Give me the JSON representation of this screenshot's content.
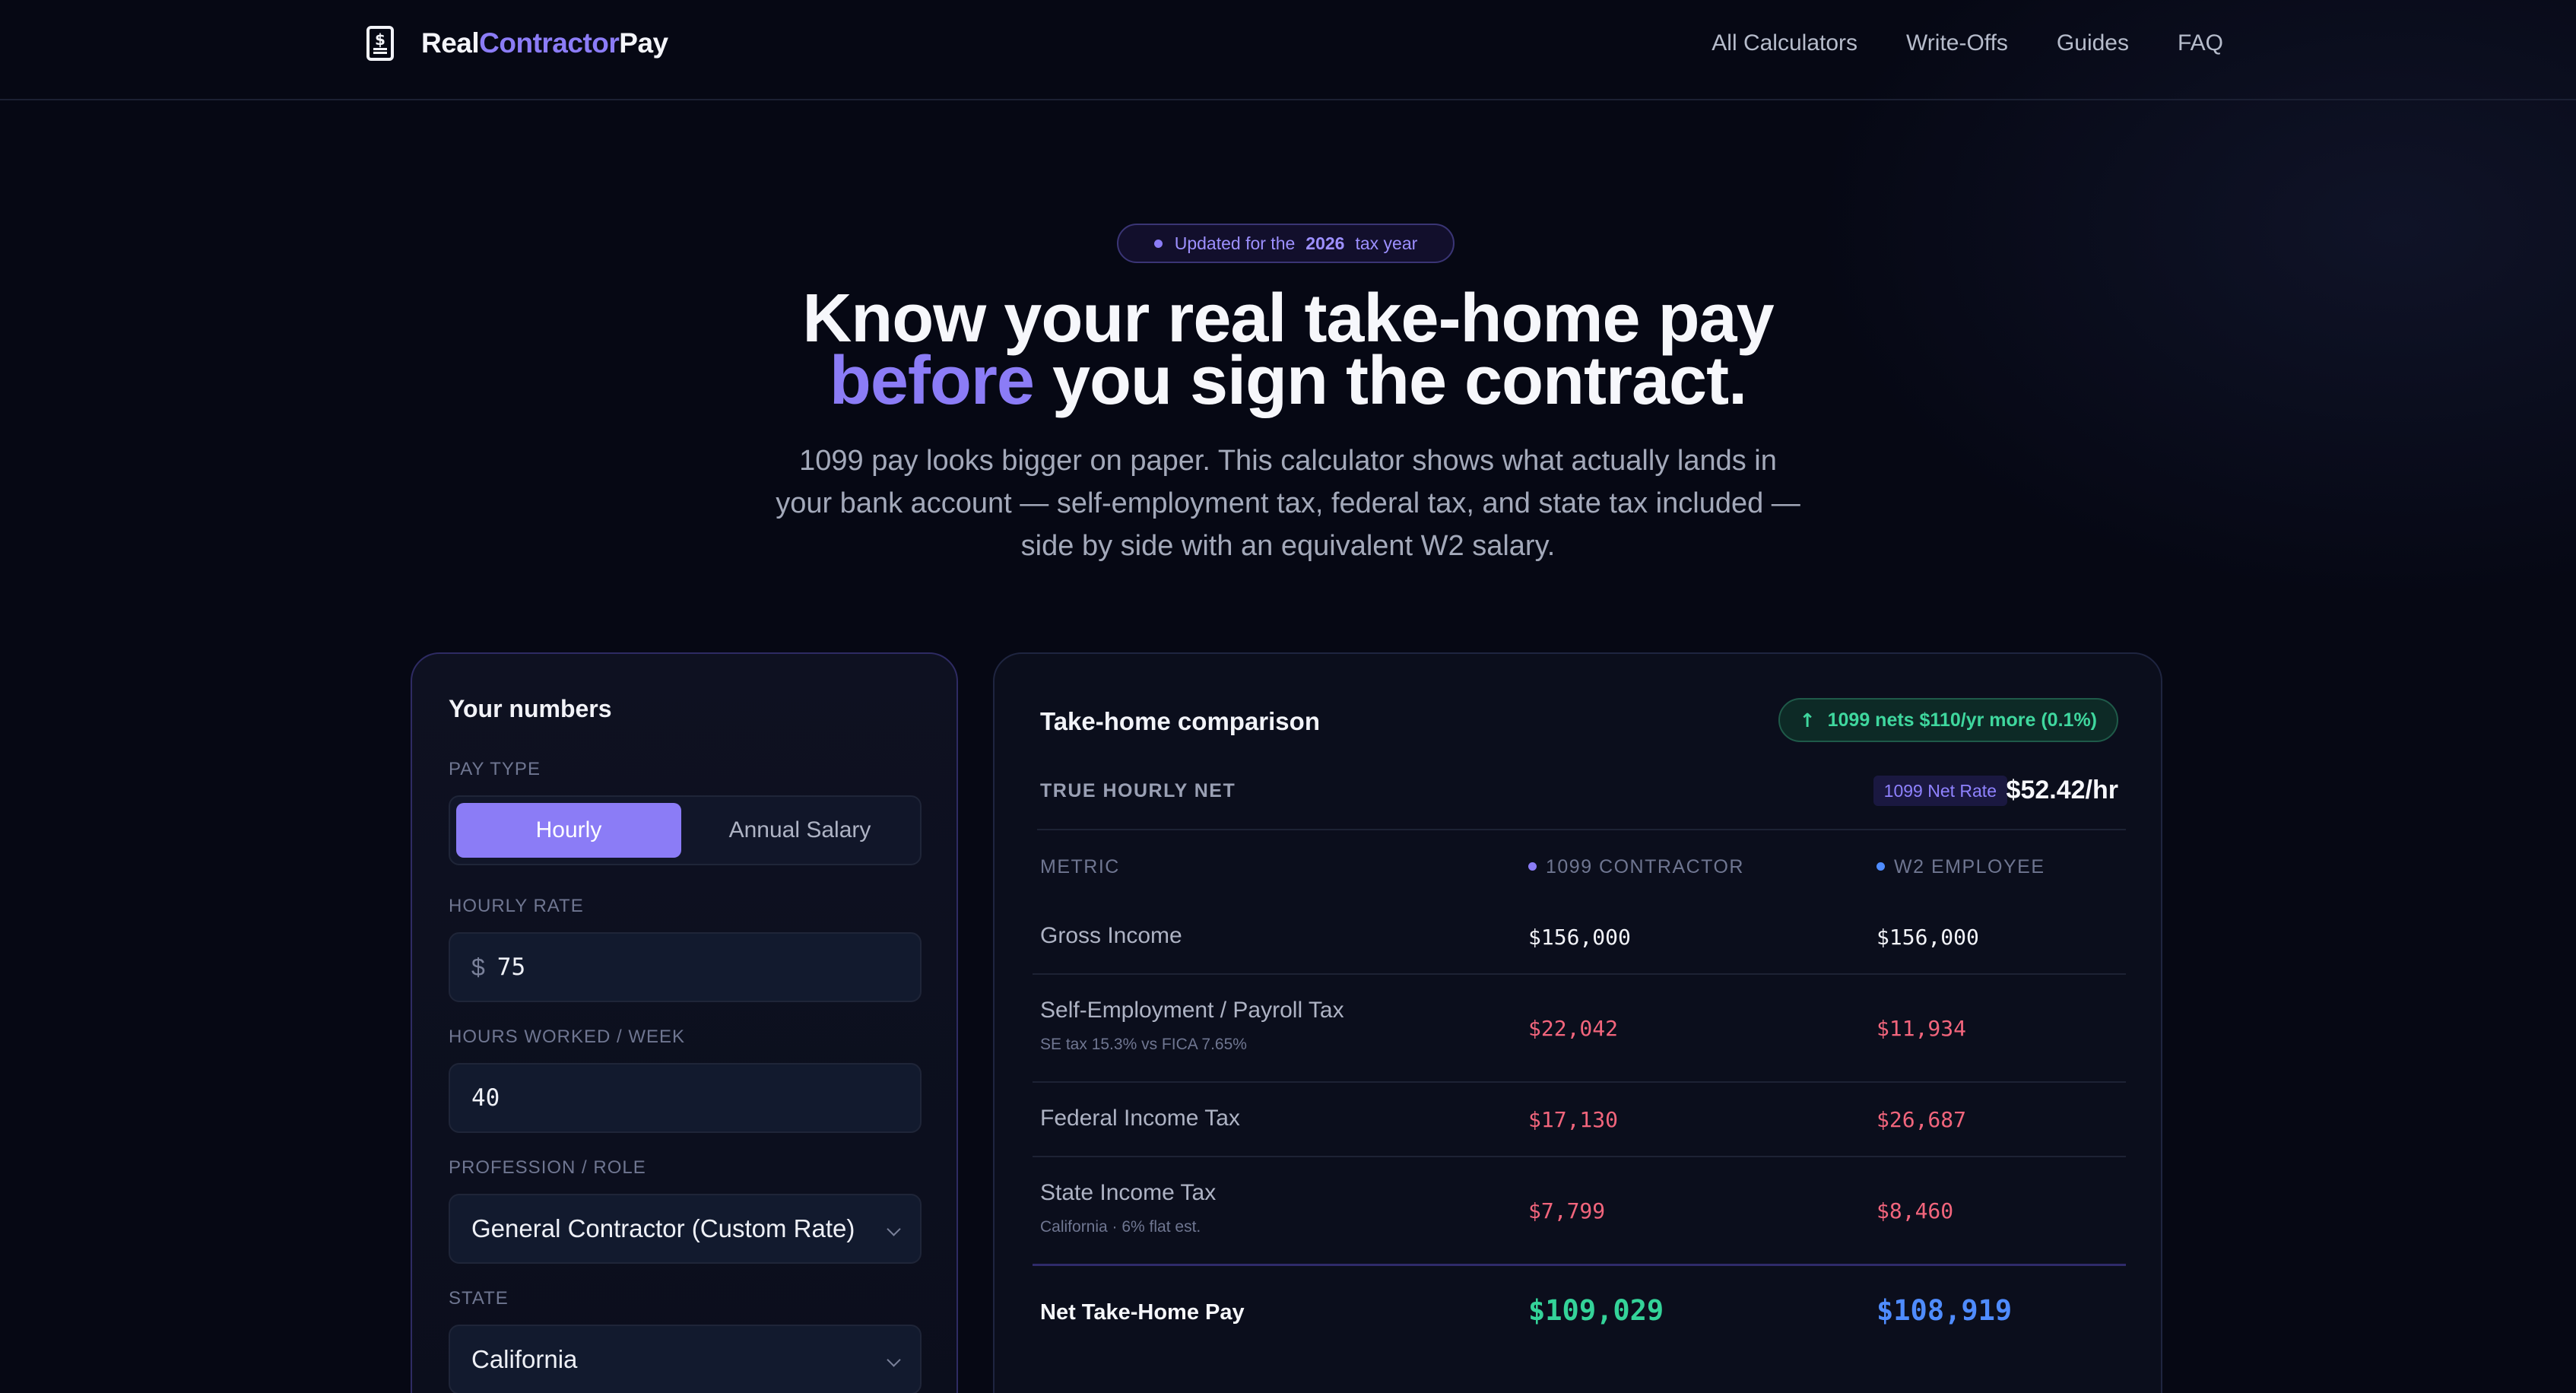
{
  "nav": {
    "brand": {
      "part1": "Real",
      "part2": "Contractor",
      "part3": "Pay"
    },
    "links": [
      "All Calculators",
      "Write-Offs",
      "Guides",
      "FAQ"
    ]
  },
  "hero": {
    "pill": {
      "before": "Updated for the",
      "year": "2026",
      "after": "tax year"
    },
    "title_line1": "Know your real take-home pay",
    "title_accent": "before",
    "title_line2_rest": " you sign the contract.",
    "subtitle": "1099 pay looks bigger on paper. This calculator shows what actually lands in your bank account — self-employment tax, federal tax, and state tax included — side by side with an equivalent W2 salary."
  },
  "inputs": {
    "heading": "Your numbers",
    "pay_type": {
      "label": "PAY TYPE",
      "options": [
        "Hourly",
        "Annual Salary"
      ],
      "selected": "Hourly"
    },
    "hourly_rate": {
      "label": "HOURLY RATE",
      "currency": "$",
      "value": "75"
    },
    "hours": {
      "label": "HOURS WORKED / WEEK",
      "value": "40"
    },
    "profession": {
      "label": "PROFESSION / ROLE",
      "value": "General Contractor (Custom Rate)"
    },
    "state": {
      "label": "STATE",
      "value": "California"
    }
  },
  "comparison": {
    "title": "Take-home comparison",
    "badge": "1099 nets $110/yr more (0.1%)",
    "true_hourly": {
      "label": "TRUE HOURLY NET",
      "chip": "1099 Net Rate",
      "value": "$52.42/hr"
    },
    "columns": {
      "metric": "METRIC",
      "contractor": "1099 CONTRACTOR",
      "employee": "W2 EMPLOYEE"
    },
    "rows": [
      {
        "label": "Gross Income",
        "sub": "",
        "c1099": "$156,000",
        "w2": "$156,000"
      },
      {
        "label": "Self-Employment / Payroll Tax",
        "sub": "SE tax 15.3% vs FICA 7.65%",
        "c1099": "$22,042",
        "w2": "$11,934"
      },
      {
        "label": "Federal Income Tax",
        "sub": "",
        "c1099": "$17,130",
        "w2": "$26,687"
      },
      {
        "label": "State Income Tax",
        "sub": "California · 6% flat est.",
        "c1099": "$7,799",
        "w2": "$8,460"
      }
    ],
    "total": {
      "label": "Net Take-Home Pay",
      "c1099": "$109,029",
      "w2": "$108,919"
    }
  },
  "colors": {
    "accent": "#8b7cf6",
    "positive": "#34d399",
    "negative": "#f2657c",
    "w2": "#4f8cff",
    "background": "#060814"
  },
  "icons": {
    "brand": "phone-dollar-icon",
    "badge": "arrow-up-icon",
    "select": "chevron-down-icon"
  }
}
